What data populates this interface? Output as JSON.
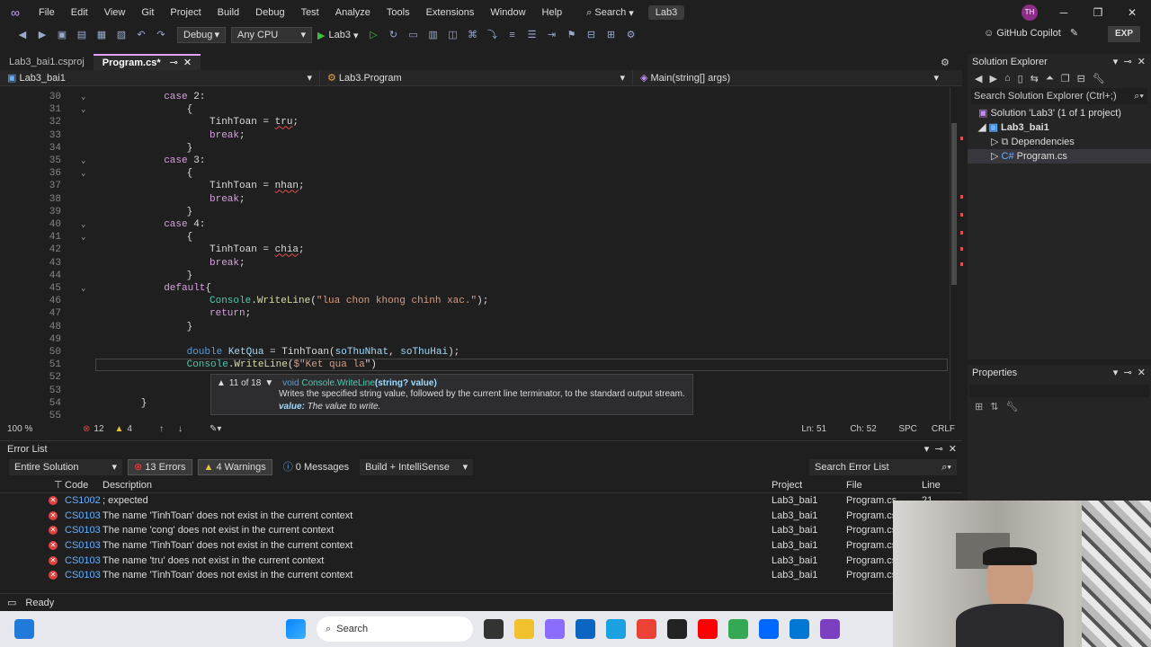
{
  "titlebar": {
    "menu": [
      "File",
      "Edit",
      "View",
      "Git",
      "Project",
      "Build",
      "Debug",
      "Test",
      "Analyze",
      "Tools",
      "Extensions",
      "Window",
      "Help"
    ],
    "search_label": "Search",
    "solution_name": "Lab3",
    "avatar_initials": "TH"
  },
  "toolbar": {
    "config": "Debug",
    "platform": "Any CPU",
    "run_target": "Lab3",
    "copilot": "GitHub Copilot",
    "exp": "EXP"
  },
  "doc_tabs": [
    {
      "label": "Lab3_bai1.csproj"
    },
    {
      "label": "Program.cs*"
    }
  ],
  "navbar": {
    "project": "Lab3_bai1",
    "class": "Lab3.Program",
    "member": "Main(string[] args)"
  },
  "code_lines": [
    {
      "n": "30",
      "indent": 12,
      "fold": true,
      "tokens": [
        [
          "kw",
          "case "
        ],
        [
          "plain",
          "2:"
        ]
      ]
    },
    {
      "n": "31",
      "indent": 16,
      "fold": true,
      "tokens": [
        [
          "plain",
          "{"
        ]
      ]
    },
    {
      "n": "32",
      "indent": 20,
      "fold": false,
      "tokens": [
        [
          "plain",
          "TinhToan = "
        ],
        [
          "plain",
          "tru"
        ],
        [
          "plain",
          ";"
        ]
      ]
    },
    {
      "n": "33",
      "indent": 20,
      "fold": false,
      "tokens": [
        [
          "kw",
          "break"
        ],
        [
          "plain",
          ";"
        ]
      ]
    },
    {
      "n": "34",
      "indent": 16,
      "fold": false,
      "tokens": [
        [
          "plain",
          "}"
        ]
      ]
    },
    {
      "n": "35",
      "indent": 12,
      "fold": true,
      "tokens": [
        [
          "kw",
          "case "
        ],
        [
          "plain",
          "3:"
        ]
      ]
    },
    {
      "n": "36",
      "indent": 16,
      "fold": true,
      "tokens": [
        [
          "plain",
          "{"
        ]
      ]
    },
    {
      "n": "37",
      "indent": 20,
      "fold": false,
      "tokens": [
        [
          "plain",
          "TinhToan = "
        ],
        [
          "plain",
          "nhan"
        ],
        [
          "plain",
          ";"
        ]
      ]
    },
    {
      "n": "38",
      "indent": 20,
      "fold": false,
      "tokens": [
        [
          "kw",
          "break"
        ],
        [
          "plain",
          ";"
        ]
      ]
    },
    {
      "n": "39",
      "indent": 16,
      "fold": false,
      "tokens": [
        [
          "plain",
          "}"
        ]
      ]
    },
    {
      "n": "40",
      "indent": 12,
      "fold": true,
      "tokens": [
        [
          "kw",
          "case "
        ],
        [
          "plain",
          "4:"
        ]
      ]
    },
    {
      "n": "41",
      "indent": 16,
      "fold": true,
      "tokens": [
        [
          "plain",
          "{"
        ]
      ]
    },
    {
      "n": "42",
      "indent": 20,
      "fold": false,
      "tokens": [
        [
          "plain",
          "TinhToan = "
        ],
        [
          "plain",
          "chia"
        ],
        [
          "plain",
          ";"
        ]
      ]
    },
    {
      "n": "43",
      "indent": 20,
      "fold": false,
      "tokens": [
        [
          "kw",
          "break"
        ],
        [
          "plain",
          ";"
        ]
      ]
    },
    {
      "n": "44",
      "indent": 16,
      "fold": false,
      "tokens": [
        [
          "plain",
          "}"
        ]
      ]
    },
    {
      "n": "45",
      "indent": 12,
      "fold": true,
      "tokens": [
        [
          "kw",
          "default"
        ],
        [
          "plain",
          "{"
        ]
      ]
    },
    {
      "n": "46",
      "indent": 20,
      "fold": false,
      "tokens": [
        [
          "ty",
          "Console"
        ],
        [
          "plain",
          "."
        ],
        [
          "fn",
          "WriteLine"
        ],
        [
          "plain",
          "("
        ],
        [
          "str",
          "\"lua chon khong chinh xac.\""
        ],
        [
          "plain",
          ");"
        ]
      ]
    },
    {
      "n": "47",
      "indent": 20,
      "fold": false,
      "tokens": [
        [
          "kw",
          "return"
        ],
        [
          "plain",
          ";"
        ]
      ]
    },
    {
      "n": "48",
      "indent": 16,
      "fold": false,
      "tokens": [
        [
          "plain",
          "}"
        ]
      ]
    },
    {
      "n": "49",
      "indent": 0,
      "fold": false,
      "tokens": []
    },
    {
      "n": "50",
      "indent": 16,
      "fold": false,
      "tokens": [
        [
          "kwb",
          "double "
        ],
        [
          "var",
          "KetQua"
        ],
        [
          "plain",
          " = TinhToan("
        ],
        [
          "var",
          "soThuNhat"
        ],
        [
          "plain",
          ", "
        ],
        [
          "var",
          "soThuHai"
        ],
        [
          "plain",
          ");"
        ]
      ]
    },
    {
      "n": "51",
      "indent": 16,
      "fold": false,
      "tokens": [
        [
          "ty",
          "Console"
        ],
        [
          "plain",
          "."
        ],
        [
          "fn",
          "WriteLine"
        ],
        [
          "plain",
          "("
        ],
        [
          "str",
          "$\"Ket qua la"
        ],
        [
          "plain",
          "\")"
        ]
      ]
    },
    {
      "n": "52",
      "indent": 0,
      "fold": false,
      "tokens": []
    },
    {
      "n": "53",
      "indent": 0,
      "fold": false,
      "tokens": []
    },
    {
      "n": "54",
      "indent": 8,
      "fold": false,
      "tokens": [
        [
          "plain",
          "}"
        ]
      ]
    },
    {
      "n": "55",
      "indent": 0,
      "fold": false,
      "tokens": []
    }
  ],
  "tooltip": {
    "counter": "11 of 18",
    "signature_void": "void",
    "signature_name": "Console.WriteLine",
    "signature_params": "(string? value)",
    "description": "Writes the specified string value, followed by the current line terminator, to the standard output stream.",
    "param_name": "value:",
    "param_desc": "The value to write."
  },
  "editor_status": {
    "zoom": "100 %",
    "errors": "12",
    "warnings": "4",
    "ln": "Ln: 51",
    "ch": "Ch: 52",
    "spc": "SPC",
    "crlf": "CRLF"
  },
  "solution_explorer": {
    "title": "Solution Explorer",
    "search_placeholder": "Search Solution Explorer (Ctrl+;)",
    "solution": "Solution 'Lab3' (1 of 1 project)",
    "project": "Lab3_bai1",
    "dependencies": "Dependencies",
    "program": "Program.cs"
  },
  "properties": {
    "title": "Properties"
  },
  "error_list": {
    "title": "Error List",
    "scope": "Entire Solution",
    "errors": "13 Errors",
    "warnings": "4 Warnings",
    "messages": "0 Messages",
    "build": "Build + IntelliSense",
    "search_placeholder": "Search Error List",
    "headers": {
      "code": "Code",
      "description": "Description",
      "project": "Project",
      "file": "File",
      "line": "Line"
    },
    "rows": [
      {
        "code": "CS1002",
        "desc": "; expected",
        "project": "Lab3_bai1",
        "file": "Program.cs",
        "line": "21"
      },
      {
        "code": "CS0103",
        "desc": "The name 'TinhToan' does not exist in the current context",
        "project": "Lab3_bai1",
        "file": "Program.cs",
        "line": ""
      },
      {
        "code": "CS0103",
        "desc": "The name 'cong' does not exist in the current context",
        "project": "Lab3_bai1",
        "file": "Program.cs",
        "line": ""
      },
      {
        "code": "CS0103",
        "desc": "The name 'TinhToan' does not exist in the current context",
        "project": "Lab3_bai1",
        "file": "Program.cs",
        "line": ""
      },
      {
        "code": "CS0103",
        "desc": "The name 'tru' does not exist in the current context",
        "project": "Lab3_bai1",
        "file": "Program.cs",
        "line": ""
      },
      {
        "code": "CS0103",
        "desc": "The name 'TinhToan' does not exist in the current context",
        "project": "Lab3_bai1",
        "file": "Program.cs",
        "line": ""
      }
    ]
  },
  "statusbar": {
    "ready": "Ready"
  },
  "taskbar": {
    "search": "Search"
  }
}
